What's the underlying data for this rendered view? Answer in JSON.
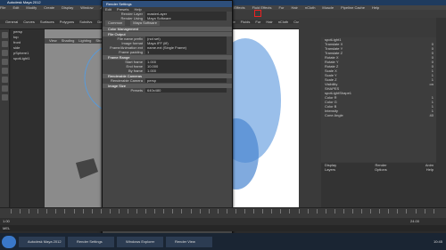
{
  "window": {
    "title": "Autodesk Maya 2012"
  },
  "menus": [
    "File",
    "Edit",
    "Modify",
    "Create",
    "Display",
    "Window",
    "Assets",
    "Lighting/Shading",
    "Texturing",
    "Render",
    "Toon",
    "Stereo",
    "Paint Effects",
    "Fluid Effects",
    "Fur",
    "Hair",
    "nCloth",
    "Muscle",
    "Pipeline Cache",
    "Help"
  ],
  "shelf_tabs": [
    "General",
    "Curves",
    "Surfaces",
    "Polygons",
    "Subdivs",
    "Deformation",
    "Animation",
    "Dynamics",
    "Rendering",
    "PaintEffects",
    "Toon",
    "Muscle",
    "Fluids",
    "Fur",
    "Hair",
    "nCloth",
    "Custom"
  ],
  "outliner": {
    "items": [
      "persp",
      "top",
      "front",
      "side",
      "pSphere1",
      "spotLight1"
    ]
  },
  "viewport_menu": [
    "View",
    "Shading",
    "Lighting",
    "Show",
    "Renderer",
    "Panels"
  ],
  "render_settings": {
    "title": "Render Settings",
    "menu": [
      "Edit",
      "Presets",
      "Help"
    ],
    "render_layer_label": "Render Layer",
    "render_layer_value": "masterLayer",
    "render_using_label": "Render Using",
    "render_using_value": "Maya Software",
    "tabs": [
      "Common",
      "Maya Software"
    ],
    "sections": {
      "color": "Color Management",
      "file": "File Output",
      "frame": "Frame Range",
      "cameras": "Renderable Cameras",
      "image_size": "Image Size"
    },
    "rows": [
      {
        "label": "File name prefix",
        "value": "(not set)"
      },
      {
        "label": "Image format",
        "value": "Maya IFF (iff)"
      },
      {
        "label": "Frame/Animation ext",
        "value": "name.ext (Single Frame)"
      },
      {
        "label": "Frame padding",
        "value": "1"
      },
      {
        "label": "Start frame",
        "value": "1.000"
      },
      {
        "label": "End frame",
        "value": "10.000"
      },
      {
        "label": "By frame",
        "value": "1.000"
      },
      {
        "label": "Renderable Camera",
        "value": "persp"
      },
      {
        "label": "Presets",
        "value": "640x480"
      }
    ],
    "close_label": "Close"
  },
  "channel_box": {
    "object": "spotLight1",
    "channels": [
      {
        "name": "Translate X",
        "value": "0"
      },
      {
        "name": "Translate Y",
        "value": "0"
      },
      {
        "name": "Translate Z",
        "value": "0"
      },
      {
        "name": "Rotate X",
        "value": "0"
      },
      {
        "name": "Rotate Y",
        "value": "0"
      },
      {
        "name": "Rotate Z",
        "value": "0"
      },
      {
        "name": "Scale X",
        "value": "1"
      },
      {
        "name": "Scale Y",
        "value": "1"
      },
      {
        "name": "Scale Z",
        "value": "1"
      },
      {
        "name": "Visibility",
        "value": "on"
      }
    ],
    "shapes_label": "SHAPES",
    "shape_name": "spotLightShape1",
    "shape_channels": [
      {
        "name": "Color R",
        "value": "1"
      },
      {
        "name": "Color G",
        "value": "1"
      },
      {
        "name": "Color B",
        "value": "1"
      },
      {
        "name": "Intensity",
        "value": "1"
      },
      {
        "name": "Cone Angle",
        "value": "40"
      }
    ]
  },
  "layer_panel": {
    "tabs": [
      "Display",
      "Render",
      "Anim"
    ],
    "menu": [
      "Layers",
      "Options",
      "Help"
    ]
  },
  "timeline": {
    "start": "1.00",
    "end": "24.00",
    "current": "1.00"
  },
  "command_line": "MEL",
  "taskbar": {
    "items": [
      "Autodesk Maya 2012",
      "Render Settings",
      "Windows Explorer",
      "Render View"
    ],
    "time": "10:45"
  },
  "colors": {
    "accent": "#2e4f7b",
    "highlight": "#e22222"
  }
}
